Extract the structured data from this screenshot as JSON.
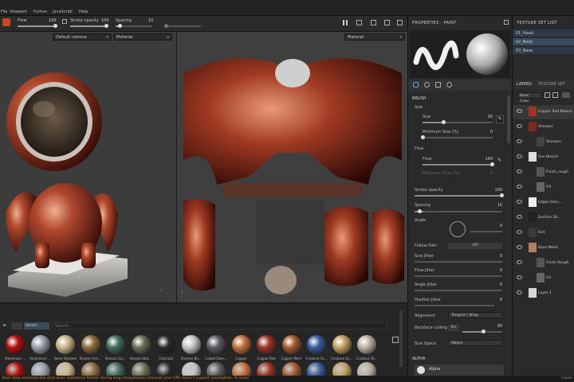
{
  "menu": {
    "items": [
      "File",
      "Viewport",
      "Python",
      "JavaScript",
      "Help"
    ]
  },
  "toolbar": {
    "flow_label": "Flow",
    "flow_value": "100",
    "stroke_opacity_label": "Stroke opacity",
    "stroke_opacity_value": "100",
    "spacing_label": "Spacing",
    "spacing_value": "10"
  },
  "viewport": {
    "camera_select": "Default camera",
    "mode_select_3d": "Material",
    "mode_select_2d": "Material"
  },
  "shelf": {
    "search_placeholder": "Search...",
    "filter_chip": "Smart...",
    "materials": [
      {
        "name": "Aluminium ...",
        "color": "#b01010"
      },
      {
        "name": "Aluminium ...",
        "color": "#9aa0a8"
      },
      {
        "name": "Bone Stylized",
        "color": "#c9b58a"
      },
      {
        "name": "Bronze Arm...",
        "color": "#8a6a3a"
      },
      {
        "name": "Bronze Cor...",
        "color": "#3f6b5a"
      },
      {
        "name": "Bronze Stat...",
        "color": "#6b6b58"
      },
      {
        "name": "Charcoal",
        "color": "#2a2a2a"
      },
      {
        "name": "Chrome Bli...",
        "color": "#c5c5c5"
      },
      {
        "name": "Cobalt Dam...",
        "color": "#5a5a60"
      },
      {
        "name": "Copper",
        "color": "#c4703c"
      },
      {
        "name": "Copper Red",
        "color": "#9c3428"
      },
      {
        "name": "Copper Worn",
        "color": "#a45a30"
      },
      {
        "name": "Creature Sc...",
        "color": "#3a5a9a"
      },
      {
        "name": "Creature Sc...",
        "color": "#c0a060"
      },
      {
        "name": "Creature Te...",
        "color": "#b8b0a0"
      }
    ]
  },
  "status": {
    "message": "Stem data automatically shut down Substance Painter during long computations because your GPU doesn't support preemption. To avoid"
  },
  "properties": {
    "title": "PROPERTIES - PAINT",
    "brush_section": "BRUSH",
    "size_label": "Size",
    "size_field_label": "Size",
    "size_value": "30",
    "min_size_label": "Minimum Size (%)",
    "min_size_value": "0",
    "flow_section": "Flow",
    "flow_label": "Flow",
    "flow_value": "100",
    "min_flow_label": "Minimum Flow (%)",
    "min_flow_value": "0",
    "stroke_opacity_label": "Stroke opacity",
    "stroke_opacity_value": "100",
    "spacing_label": "Spacing",
    "spacing_value": "10",
    "angle_label": "Angle",
    "angle_value": "0",
    "follow_path_label": "Follow Path",
    "follow_path_value": "Off",
    "size_jitter_label": "Size Jitter",
    "size_jitter_value": "0",
    "flow_jitter_label": "Flow Jitter",
    "flow_jitter_value": "0",
    "angle_jitter_label": "Angle Jitter",
    "angle_jitter_value": "0",
    "position_jitter_label": "Position Jitter",
    "position_jitter_value": "0",
    "alignment_label": "Alignment",
    "alignment_value": "Tangent | Wrap",
    "backface_label": "Backface culling",
    "backface_toggle": "On",
    "backface_value": "90",
    "size_space_label": "Size Space",
    "size_space_value": "Object",
    "alpha_section": "ALPHA",
    "alpha_name": "Alpha"
  },
  "texture_set_list": {
    "title": "TEXTURE SET LIST",
    "items": [
      "01_Head",
      "02_Body",
      "03_Base"
    ]
  },
  "layers": {
    "tab_layers": "LAYERS",
    "tab_texture_set": "TEXTURE SET",
    "channel_select": "Base Color",
    "rows": [
      {
        "name": "Copper Red Bleach",
        "thumb": "#9c3428"
      },
      {
        "name": "Sharpen",
        "thumb": "#7a2a22"
      },
      {
        "name": "Sharpen",
        "thumb": "#444"
      },
      {
        "name": "Sun Bleach",
        "thumb": "#ddd"
      },
      {
        "name": "Finish_rough",
        "thumb": "#555"
      },
      {
        "name": "Fill",
        "thumb": "#666"
      },
      {
        "name": "Edges Dam...",
        "thumb": "#eee"
      },
      {
        "name": "Surface Dir...",
        "thumb": "#222"
      },
      {
        "name": "Dirt",
        "thumb": "#3a3a3a"
      },
      {
        "name": "Base Metal",
        "thumb": "#b08060"
      },
      {
        "name": "Finish Rough",
        "thumb": "#555"
      },
      {
        "name": "Fill",
        "thumb": "#666"
      },
      {
        "name": "Layer 1",
        "thumb": "#d8d8d8"
      }
    ]
  },
  "statusbar_right": "Cache"
}
